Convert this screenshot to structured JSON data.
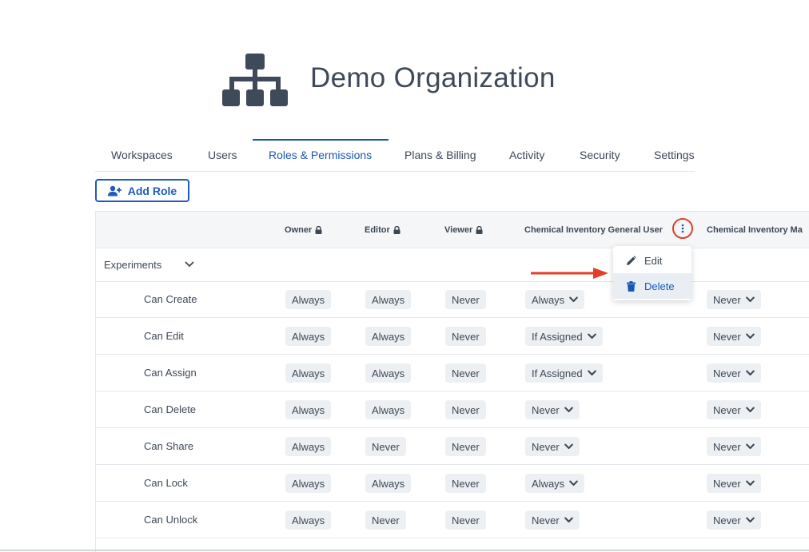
{
  "org": {
    "name": "Demo Organization",
    "icon": "org-chart-icon"
  },
  "tabs": [
    "Workspaces",
    "Users",
    "Roles & Permissions",
    "Plans & Billing",
    "Activity",
    "Security",
    "Settings"
  ],
  "active_tab": "Roles & Permissions",
  "actions": {
    "add_role_label": "Add Role"
  },
  "table": {
    "columns": [
      "Owner",
      "Editor",
      "Viewer",
      "Chemical Inventory General User",
      "Chemical Inventory Ma"
    ],
    "locked_columns": [
      "Owner",
      "Editor",
      "Viewer"
    ],
    "group": "Experiments",
    "rows": [
      {
        "label": "Can Create",
        "values": [
          "Always",
          "Always",
          "Never",
          "Always",
          "Never"
        ]
      },
      {
        "label": "Can Edit",
        "values": [
          "Always",
          "Always",
          "Never",
          "If Assigned",
          "Never"
        ]
      },
      {
        "label": "Can Assign",
        "values": [
          "Always",
          "Always",
          "Never",
          "If Assigned",
          "Never"
        ]
      },
      {
        "label": "Can Delete",
        "values": [
          "Always",
          "Always",
          "Never",
          "Never",
          "Never"
        ]
      },
      {
        "label": "Can Share",
        "values": [
          "Always",
          "Never",
          "Never",
          "Never",
          "Never"
        ]
      },
      {
        "label": "Can Lock",
        "values": [
          "Always",
          "Always",
          "Never",
          "Always",
          "Never"
        ]
      },
      {
        "label": "Can Unlock",
        "values": [
          "Always",
          "Never",
          "Never",
          "Never",
          "Never"
        ]
      }
    ]
  },
  "context_menu": {
    "edit_label": "Edit",
    "delete_label": "Delete"
  },
  "colors": {
    "accent": "#1a56b8",
    "highlight": "#e33d2a",
    "text": "#3c4856",
    "pill_bg": "#edf0f3"
  }
}
